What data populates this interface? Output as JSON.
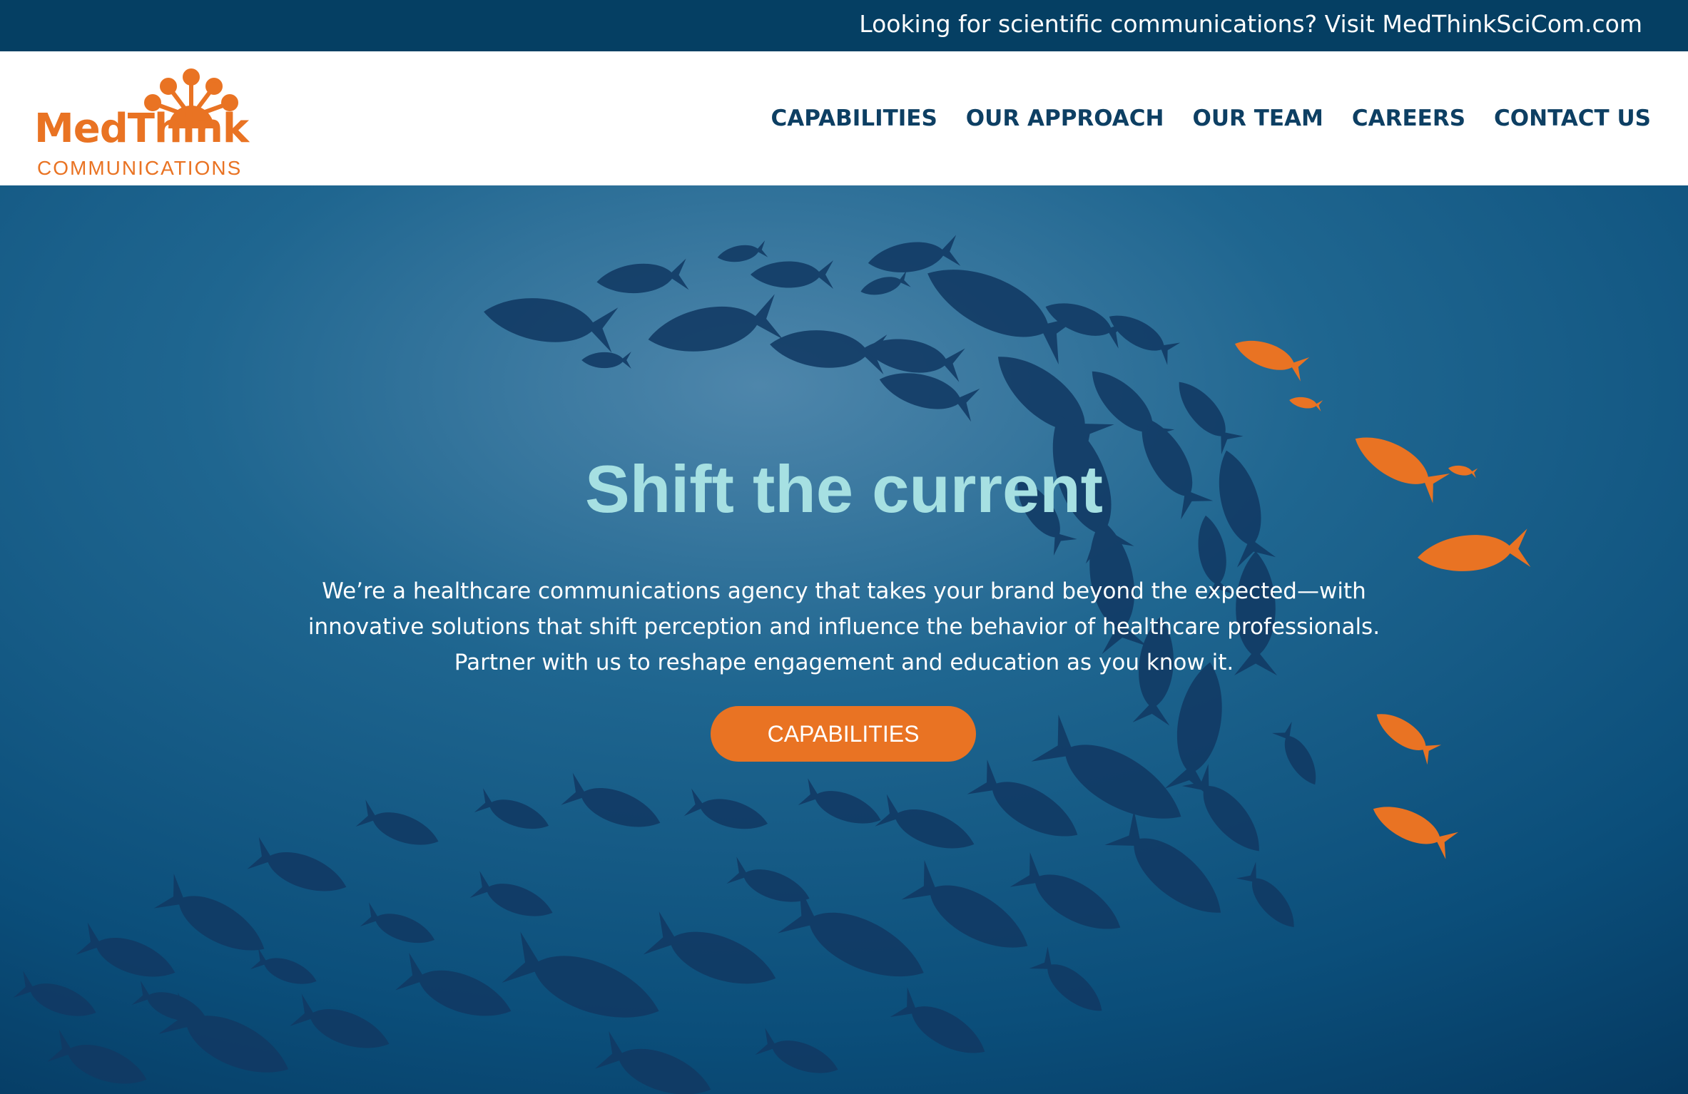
{
  "colors": {
    "topbar": "#053f63",
    "nav_text": "#0d3f63",
    "brand_orange": "#e97323",
    "headline": "#a6e0e2",
    "fish_dark": "#123a63"
  },
  "topbar": {
    "text": "Looking for scientific communications? Visit MedThinkSciCom.com"
  },
  "logo": {
    "name": "MedThink",
    "subtitle": "COMMUNICATIONS",
    "icon": "sunburst-logo-icon"
  },
  "nav": {
    "items": [
      "CAPABILITIES",
      "OUR APPROACH",
      "OUR TEAM",
      "CAREERS",
      "CONTACT US"
    ]
  },
  "hero": {
    "title": "Shift the current",
    "body_lines": [
      "We’re a healthcare communications agency that takes your brand beyond the expected—with",
      "innovative solutions that shift perception and influence the behavior of healthcare professionals.",
      "Partner with us to reshape engagement and education as you know it."
    ],
    "cta_label": "CAPABILITIES",
    "background": "school-of-fish-illustration"
  }
}
